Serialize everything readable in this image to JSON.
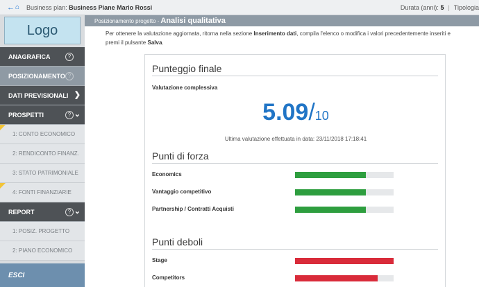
{
  "topbar": {
    "business_plan_label": "Business plan:",
    "business_plan_name": "Business Piane Mario Rossi",
    "duration_label": "Durata (anni):",
    "duration_value": "5",
    "tipologia_label": "Tipologia"
  },
  "sidebar": {
    "logo": "Logo",
    "items": [
      {
        "label": "ANAGRAFICA",
        "help": "?"
      },
      {
        "label": "POSIZIONAMENTO",
        "help": "?"
      },
      {
        "label": "DATI PREVISIONALI"
      },
      {
        "label": "PROSPETTI",
        "help": "?"
      }
    ],
    "prospetti_sub": [
      "1:  CONTO ECONOMICO",
      "2:  RENDICONTO FINANZ.",
      "3:  STATO PATRIMONIALE",
      "4:  FONTI FINANZIARIE"
    ],
    "report": {
      "label": "REPORT",
      "help": "?"
    },
    "report_sub": [
      "1:  POSIZ. PROGETTO",
      "2:  PIANO ECONOMICO"
    ],
    "exit": "ESCI"
  },
  "main": {
    "breadcrumb": "Posizionamento progetto -",
    "title": "Analisi qualitativa",
    "intro_pre": "Per ottenere la valutazione aggiornata, ritorna nella sezione ",
    "intro_bold": "Inserimento dati",
    "intro_post": ", compila l'elenco o modifica i valori precedentemente inseriti e premi il pulsante ",
    "intro_save": "Salva",
    "intro_end": "."
  },
  "final_score": {
    "title": "Punteggio finale",
    "label": "Valutazione complessiva",
    "value": "5.09",
    "slash": "/",
    "max": "10",
    "last_eval": "Ultima valutazione effettuata in data: 23/11/2018 17:18:41"
  },
  "strengths": {
    "title": "Punti di forza",
    "items": [
      {
        "label": "Economics",
        "level": 0.72
      },
      {
        "label": "Vantaggio competitivo",
        "level": 0.72
      },
      {
        "label": "Partnership / Contratti Acquisti",
        "level": 0.72
      }
    ]
  },
  "weaknesses": {
    "title": "Punti deboli",
    "items": [
      {
        "label": "Stage",
        "level": 1.0
      },
      {
        "label": "Competitors",
        "level": 0.84
      }
    ]
  },
  "colors": {
    "accent_blue": "#2175c6",
    "strength_green": "#2e9e3f",
    "weakness_red": "#d92b3a"
  }
}
